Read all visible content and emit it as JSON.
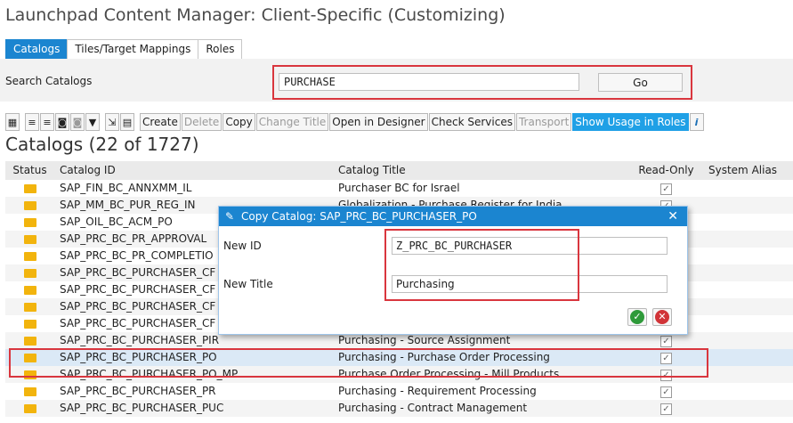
{
  "page": {
    "title": "Launchpad Content Manager: Client-Specific (Customizing)"
  },
  "tabs": [
    {
      "label": "Catalogs",
      "active": true
    },
    {
      "label": "Tiles/Target Mappings",
      "active": false
    },
    {
      "label": "Roles",
      "active": false
    }
  ],
  "search": {
    "label": "Search Catalogs",
    "value": "PURCHASE",
    "go_label": "Go"
  },
  "toolbar": {
    "create": "Create",
    "delete": "Delete",
    "copy": "Copy",
    "change_title": "Change Title",
    "open_designer": "Open in Designer",
    "check_services": "Check Services",
    "transport": "Transport",
    "show_usage": "Show Usage in Roles",
    "icons": [
      "select-all-icon",
      "align-left-icon",
      "align-right-icon",
      "find-icon",
      "find-next-icon",
      "filter-icon",
      "export-icon",
      "layout-icon",
      "info-icon"
    ]
  },
  "catalogs": {
    "heading": "Catalogs (22 of 1727)",
    "columns": [
      "Status",
      "Catalog ID",
      "Catalog Title",
      "Read-Only",
      "System Alias"
    ],
    "rows": [
      {
        "id": "SAP_FIN_BC_ANNXMM_IL",
        "title": "Purchaser BC for Israel",
        "read_only": true
      },
      {
        "id": "SAP_MM_BC_PUR_REG_IN",
        "title": "Globalization - Purchase Register for India",
        "read_only": true
      },
      {
        "id": "SAP_OIL_BC_ACM_PO",
        "title": "",
        "read_only": true
      },
      {
        "id": "SAP_PRC_BC_PR_APPROVAL",
        "title": "",
        "read_only": true
      },
      {
        "id": "SAP_PRC_BC_PR_COMPLETIO",
        "title": "",
        "read_only": true
      },
      {
        "id": "SAP_PRC_BC_PURCHASER_CF",
        "title": "",
        "read_only": true
      },
      {
        "id": "SAP_PRC_BC_PURCHASER_CF",
        "title": "",
        "read_only": true
      },
      {
        "id": "SAP_PRC_BC_PURCHASER_CF",
        "title": "",
        "read_only": true
      },
      {
        "id": "SAP_PRC_BC_PURCHASER_CF",
        "title": "",
        "read_only": true
      },
      {
        "id": "SAP_PRC_BC_PURCHASER_PIR",
        "title": "Purchasing - Source Assignment",
        "read_only": true
      },
      {
        "id": "SAP_PRC_BC_PURCHASER_PO",
        "title": "Purchasing - Purchase Order Processing",
        "read_only": true,
        "selected": true
      },
      {
        "id": "SAP_PRC_BC_PURCHASER_PO_MP",
        "title": "Purchase Order Processing - Mill Products",
        "read_only": true
      },
      {
        "id": "SAP_PRC_BC_PURCHASER_PR",
        "title": "Purchasing - Requirement Processing",
        "read_only": true
      },
      {
        "id": "SAP_PRC_BC_PURCHASER_PUC",
        "title": "Purchasing - Contract Management",
        "read_only": true
      }
    ]
  },
  "dialog": {
    "title": "Copy Catalog: SAP_PRC_BC_PURCHASER_PO",
    "new_id_label": "New ID",
    "new_id_value": "Z_PRC_BC_PURCHASER",
    "new_title_label": "New Title",
    "new_title_value": "Purchasing",
    "ok_icon": "checkmark-icon",
    "cancel_icon": "cancel-icon"
  },
  "colors": {
    "accent": "#1b85d0",
    "highlight": "#d9363e",
    "folder": "#f2b40d",
    "ok": "#2e9a3a",
    "cancel": "#d13438"
  }
}
